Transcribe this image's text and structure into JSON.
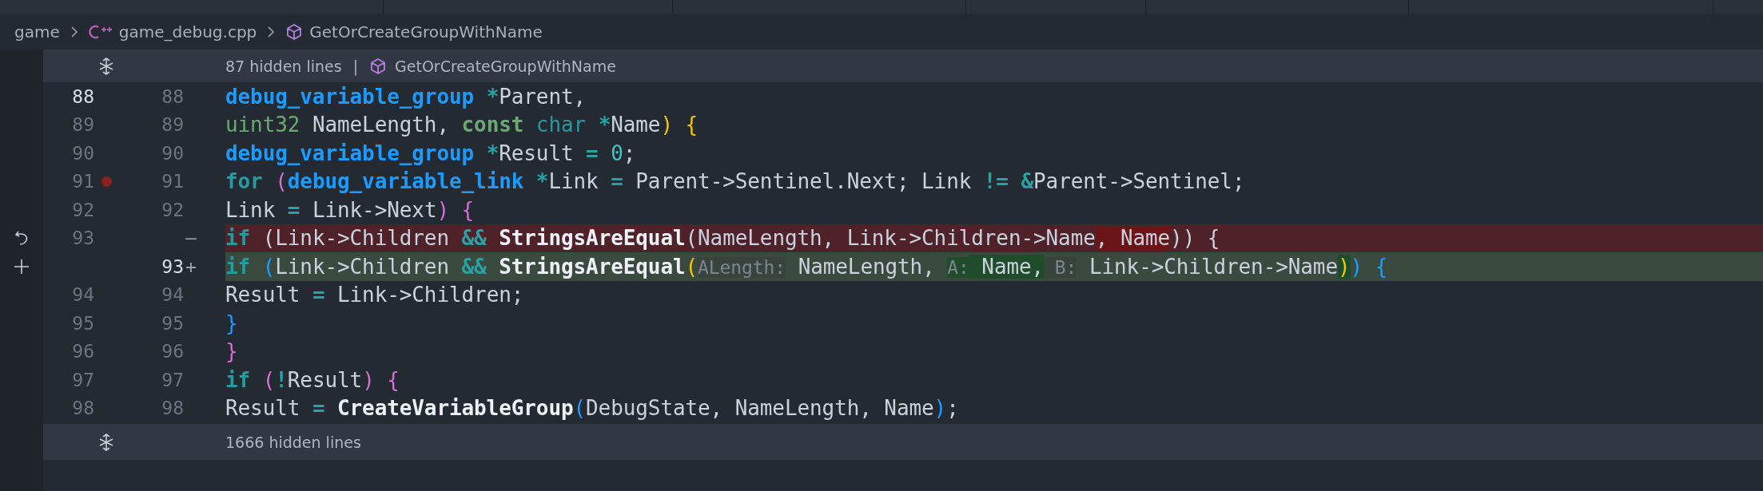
{
  "breadcrumb": [
    {
      "kind": "folder",
      "text": "game"
    },
    {
      "kind": "file",
      "text": "game_debug.cpp"
    },
    {
      "kind": "symbol",
      "text": "GetOrCreateGroupWithName"
    }
  ],
  "fold_top": {
    "text": "87 hidden lines",
    "separator": "|",
    "symbol": "GetOrCreateGroupWithName"
  },
  "rows": [
    {
      "kind": "normal",
      "left": {
        "text": "88",
        "bright": true
      },
      "right": {
        "text": "88",
        "bright": false
      },
      "breakpoint": false,
      "tokens": [
        {
          "kind": "type",
          "text": "                                                        debug_variable_group "
        },
        {
          "kind": "op",
          "text": "*"
        },
        {
          "kind": "plain",
          "text": "Parent,"
        }
      ]
    },
    {
      "kind": "normal",
      "left": {
        "text": "89",
        "bright": false
      },
      "right": {
        "text": "89",
        "bright": false
      },
      "breakpoint": false,
      "tokens": [
        {
          "kind": "prim",
          "text": "                                                        uint32"
        },
        {
          "kind": "plain",
          "text": " NameLength, "
        },
        {
          "kind": "kw2",
          "text": "const "
        },
        {
          "kind": "ctype",
          "text": "char "
        },
        {
          "kind": "op",
          "text": "*"
        },
        {
          "kind": "plain",
          "text": "Name"
        },
        {
          "kind": "bracket",
          "color": "#f2c511",
          "text": ") "
        },
        {
          "kind": "bracket",
          "color": "#f2c511",
          "text": "{"
        }
      ]
    },
    {
      "kind": "normal",
      "left": {
        "text": "90",
        "bright": false
      },
      "right": {
        "text": "90",
        "bright": false
      },
      "breakpoint": false,
      "tokens": [
        {
          "kind": "type",
          "text": "    debug_variable_group "
        },
        {
          "kind": "op",
          "text": "*"
        },
        {
          "kind": "plain",
          "text": "Result "
        },
        {
          "kind": "op",
          "text": "= "
        },
        {
          "kind": "num",
          "text": "0"
        },
        {
          "kind": "plain",
          "text": ";"
        }
      ]
    },
    {
      "kind": "normal",
      "left": {
        "text": "91",
        "bright": false
      },
      "right": {
        "text": "91",
        "bright": false
      },
      "breakpoint": true,
      "tokens": [
        {
          "kind": "kw",
          "text": "    for "
        },
        {
          "kind": "bracket",
          "color": "#d46ed4",
          "text": "("
        },
        {
          "kind": "type",
          "text": "debug_variable_link "
        },
        {
          "kind": "op",
          "text": "*"
        },
        {
          "kind": "plain",
          "text": "Link "
        },
        {
          "kind": "op",
          "text": "="
        },
        {
          "kind": "plain",
          "text": " Parent->Sentinel.Next; Link "
        },
        {
          "kind": "op",
          "text": "!= &"
        },
        {
          "kind": "plain",
          "text": "Parent->Sentinel;"
        }
      ]
    },
    {
      "kind": "normal",
      "left": {
        "text": "92",
        "bright": false
      },
      "right": {
        "text": "92",
        "bright": false
      },
      "breakpoint": false,
      "tokens": [
        {
          "kind": "plain",
          "text": "         Link "
        },
        {
          "kind": "op",
          "text": "="
        },
        {
          "kind": "plain",
          "text": " Link->Next"
        },
        {
          "kind": "bracket",
          "color": "#d46ed4",
          "text": ") "
        },
        {
          "kind": "bracket",
          "color": "#d46ed4",
          "text": "{"
        }
      ]
    },
    {
      "kind": "deleted",
      "left": {
        "text": "93",
        "bright": false
      },
      "marker": "—",
      "breakpoint": false,
      "tokens": [
        {
          "kind": "kw",
          "text": "        if"
        },
        {
          "kind": "plain",
          "text": " (Link->Children "
        },
        {
          "kind": "op",
          "text": "&& "
        },
        {
          "kind": "func",
          "text": "StringsAreEqual"
        },
        {
          "kind": "plain",
          "text": "(NameLength, Link->Children->Name"
        },
        {
          "kind": "plain",
          "changed": true,
          "text": ", Name"
        },
        {
          "kind": "plain",
          "text": ")) {"
        }
      ]
    },
    {
      "kind": "added",
      "right": {
        "text": "93",
        "bright": true
      },
      "marker": "+",
      "breakpoint": false,
      "tokens": [
        {
          "kind": "kw",
          "text": "        if "
        },
        {
          "kind": "bracket",
          "color": "#1e9bff",
          "text": "("
        },
        {
          "kind": "plain",
          "text": "Link->Children "
        },
        {
          "kind": "op",
          "text": "&& "
        },
        {
          "kind": "func",
          "text": "StringsAreEqual"
        },
        {
          "kind": "bracket",
          "color": "#f2c511",
          "text": "("
        },
        {
          "kind": "hint",
          "text": "ALength:"
        },
        {
          "kind": "plain",
          "text": " NameLength, "
        },
        {
          "kind": "hint",
          "changed": true,
          "text": "A:"
        },
        {
          "kind": "plain",
          "changed": true,
          "text": " Name,"
        },
        {
          "kind": "hint",
          "text": " B:"
        },
        {
          "kind": "plain",
          "text": " Link->Children->Name"
        },
        {
          "kind": "bracket",
          "color": "#f2c511",
          "changed": true,
          "text": ")"
        },
        {
          "kind": "bracket",
          "color": "#1e9bff",
          "text": ") "
        },
        {
          "kind": "bracket",
          "color": "#1e9bff",
          "text": "{"
        }
      ]
    },
    {
      "kind": "normal",
      "left": {
        "text": "94",
        "bright": false
      },
      "right": {
        "text": "94",
        "bright": false
      },
      "breakpoint": false,
      "tokens": [
        {
          "kind": "plain",
          "text": "            Result "
        },
        {
          "kind": "op",
          "text": "="
        },
        {
          "kind": "plain",
          "text": " Link->Children;"
        }
      ]
    },
    {
      "kind": "normal",
      "left": {
        "text": "95",
        "bright": false
      },
      "right": {
        "text": "95",
        "bright": false
      },
      "breakpoint": false,
      "tokens": [
        {
          "kind": "bracket",
          "color": "#1e9bff",
          "text": "        }"
        }
      ]
    },
    {
      "kind": "normal",
      "left": {
        "text": "96",
        "bright": false
      },
      "right": {
        "text": "96",
        "bright": false
      },
      "breakpoint": false,
      "tokens": [
        {
          "kind": "bracket",
          "color": "#d46ed4",
          "text": "    }"
        }
      ]
    },
    {
      "kind": "normal",
      "left": {
        "text": "97",
        "bright": false
      },
      "right": {
        "text": "97",
        "bright": false
      },
      "breakpoint": false,
      "tokens": [
        {
          "kind": "kw",
          "text": "    if "
        },
        {
          "kind": "bracket",
          "color": "#d46ed4",
          "text": "("
        },
        {
          "kind": "op",
          "text": "!"
        },
        {
          "kind": "plain",
          "text": "Result"
        },
        {
          "kind": "bracket",
          "color": "#d46ed4",
          "text": ") "
        },
        {
          "kind": "bracket",
          "color": "#d46ed4",
          "text": "{"
        }
      ]
    },
    {
      "kind": "normal",
      "left": {
        "text": "98",
        "bright": false
      },
      "right": {
        "text": "98",
        "bright": false
      },
      "breakpoint": false,
      "tokens": [
        {
          "kind": "plain",
          "text": "        Result "
        },
        {
          "kind": "op",
          "text": "= "
        },
        {
          "kind": "func",
          "text": "CreateVariableGroup"
        },
        {
          "kind": "bracket",
          "color": "#1e9bff",
          "text": "("
        },
        {
          "kind": "plain",
          "text": "DebugState, NameLength, Name"
        },
        {
          "kind": "bracket",
          "color": "#1e9bff",
          "text": ")"
        },
        {
          "kind": "plain",
          "text": ";"
        }
      ]
    }
  ],
  "fold_bottom": {
    "text": "1666 hidden lines"
  }
}
